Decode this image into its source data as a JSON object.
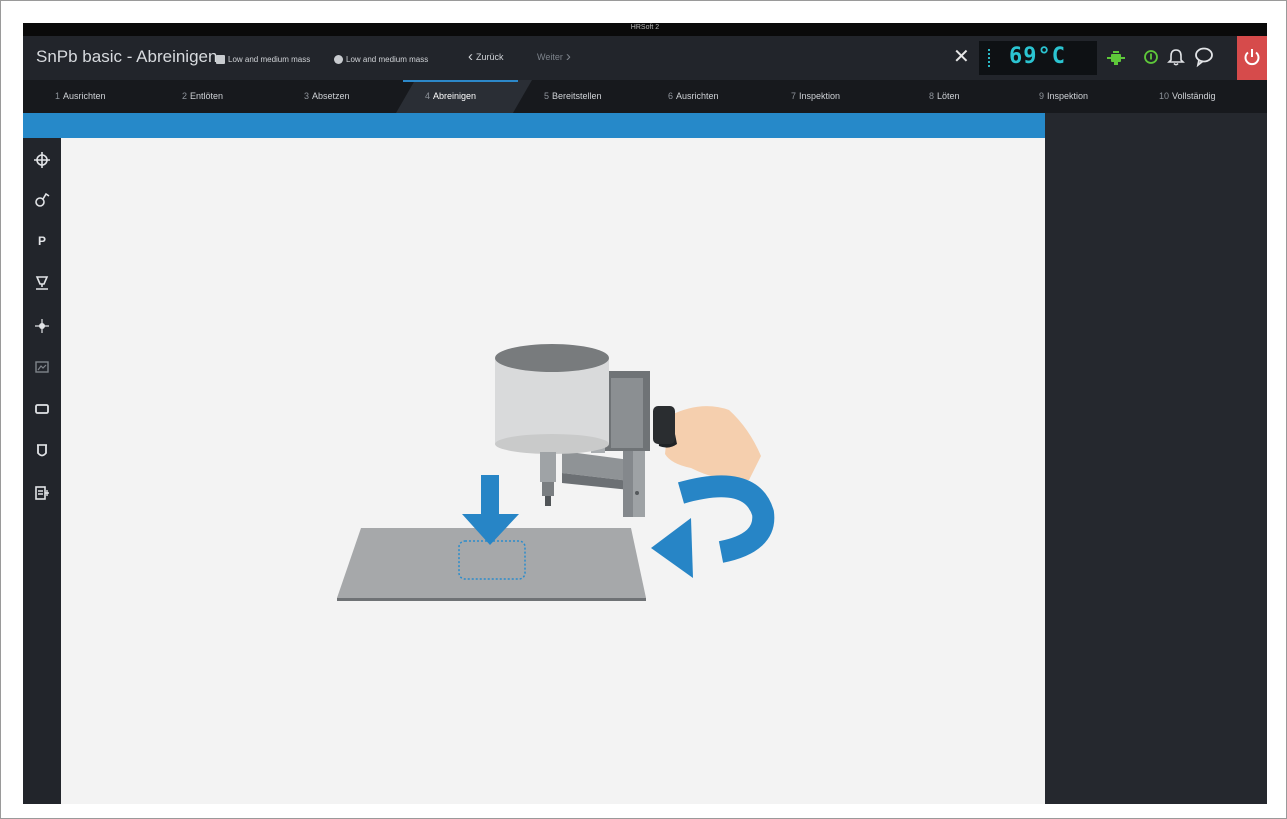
{
  "window": {
    "title": "HRSoft 2"
  },
  "header": {
    "title": "SnPb basic - Abreinigen",
    "chips": [
      {
        "icon": "component-icon",
        "label": "Low and medium mass"
      },
      {
        "icon": "nozzle-icon",
        "label": "Low and medium mass"
      }
    ],
    "back_label": "Zurück",
    "forward_label": "Weiter",
    "temperature": "69°C",
    "colors": {
      "accent": "#2689c9",
      "temperature": "#2bc4d1",
      "status_green": "#5ec83a",
      "power": "#d64b4b"
    },
    "status_icons": [
      "heater-icon",
      "info-icon",
      "bell-icon",
      "chat-icon",
      "power-icon"
    ]
  },
  "steps": [
    {
      "num": "1",
      "label": "Ausrichten"
    },
    {
      "num": "2",
      "label": "Entlöten"
    },
    {
      "num": "3",
      "label": "Absetzen"
    },
    {
      "num": "4",
      "label": "Abreinigen"
    },
    {
      "num": "5",
      "label": "Bereitstellen"
    },
    {
      "num": "6",
      "label": "Ausrichten"
    },
    {
      "num": "7",
      "label": "Inspektion"
    },
    {
      "num": "8",
      "label": "Löten"
    },
    {
      "num": "9",
      "label": "Inspektion"
    },
    {
      "num": "10",
      "label": "Vollständig"
    }
  ],
  "active_step": "4",
  "toolbar": {
    "tools": [
      "align-icon",
      "vacuum-icon",
      "p-icon",
      "nozzle-tool-icon",
      "crosshair-icon",
      "camera-icon",
      "rectangle-icon",
      "cup-icon",
      "profile-icon"
    ],
    "p_label": "P"
  }
}
